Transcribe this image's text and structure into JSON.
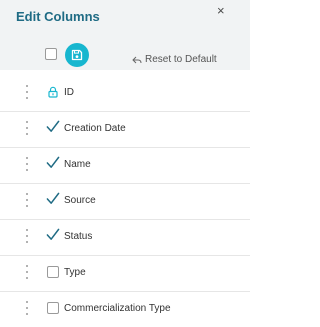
{
  "panel": {
    "title": "Edit Columns",
    "close_glyph": "×"
  },
  "toolbar": {
    "save_icon": "save-icon",
    "reset_label": "Reset to Default",
    "reset_icon": "reset-arrow-icon",
    "accent_color": "#17b6cf",
    "title_color": "#1f6b84",
    "check_color": "#1f6b84"
  },
  "columns": [
    {
      "label": "ID",
      "state": "locked"
    },
    {
      "label": "Creation Date",
      "state": "checked"
    },
    {
      "label": "Name",
      "state": "checked"
    },
    {
      "label": "Source",
      "state": "checked"
    },
    {
      "label": "Status",
      "state": "checked"
    },
    {
      "label": "Type",
      "state": "unchecked"
    },
    {
      "label": "Commercialization Type",
      "state": "unchecked"
    }
  ]
}
